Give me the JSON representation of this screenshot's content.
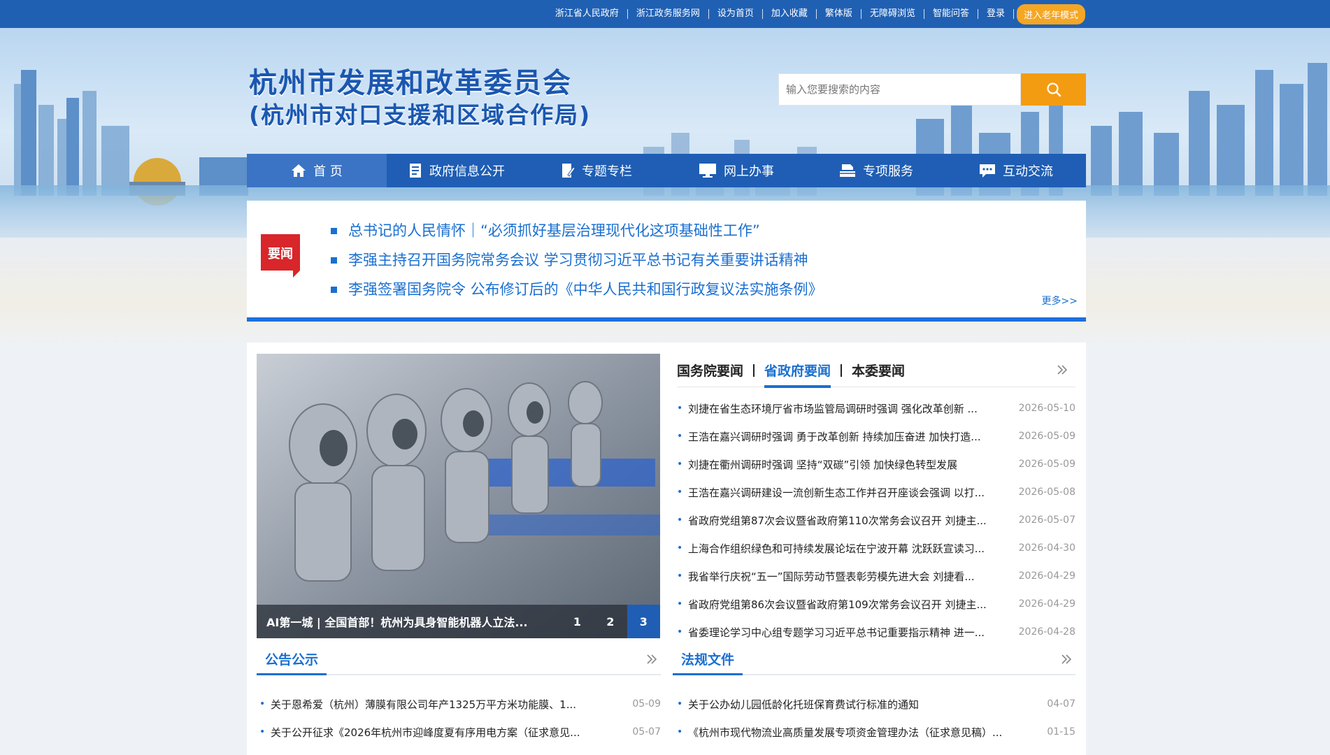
{
  "topbar": {
    "links": [
      "浙江省人民政府",
      "浙江政务服务网",
      "设为首页",
      "加入收藏",
      "繁体版",
      "无障碍浏览",
      "智能问答",
      "登录"
    ],
    "elder_mode": "进入老年模式"
  },
  "header": {
    "title_line1": "杭州市发展和改革委员会",
    "title_line2": "(杭州市对口支援和区域合作局)"
  },
  "search": {
    "placeholder": "输入您要搜索的内容"
  },
  "nav": [
    "首 页",
    "政府信息公开",
    "专题专栏",
    "网上办事",
    "专项服务",
    "互动交流"
  ],
  "headlines": {
    "badge": "要闻",
    "items": [
      "总书记的人民情怀｜“必须抓好基层治理现代化这项基础性工作”",
      "李强主持召开国务院常务会议 学习贯彻习近平总书记有关重要讲话精神",
      "李强签署国务院令 公布修订后的《中华人民共和国行政复议法实施条例》"
    ],
    "more": "更多>>"
  },
  "carousel": {
    "caption": "AI第一城 | 全国首部！杭州为具身智能机器人立法...",
    "pages": [
      "1",
      "2",
      "3"
    ],
    "active_page": "3"
  },
  "news": {
    "tabs": [
      "国务院要闻",
      "省政府要闻",
      "本委要闻"
    ],
    "active_tab": "省政府要闻",
    "items": [
      {
        "title": "刘捷在省生态环境厅省市场监管局调研时强调 强化改革创新 ...",
        "date": "2026-05-10"
      },
      {
        "title": "王浩在嘉兴调研时强调 勇于改革创新 持续加压奋进 加快打造...",
        "date": "2026-05-09"
      },
      {
        "title": "刘捷在衢州调研时强调 坚持“双碳”引领 加快绿色转型发展",
        "date": "2026-05-09"
      },
      {
        "title": "王浩在嘉兴调研建设一流创新生态工作并召开座谈会强调 以打...",
        "date": "2026-05-08"
      },
      {
        "title": "省政府党组第87次会议暨省政府第110次常务会议召开 刘捷主...",
        "date": "2026-05-07"
      },
      {
        "title": "上海合作组织绿色和可持续发展论坛在宁波开幕 沈跃跃宣读习...",
        "date": "2026-04-30"
      },
      {
        "title": "我省举行庆祝“五一”国际劳动节暨表彰劳模先进大会 刘捷看...",
        "date": "2026-04-29"
      },
      {
        "title": "省政府党组第86次会议暨省政府第109次常务会议召开 刘捷主...",
        "date": "2026-04-29"
      },
      {
        "title": "省委理论学习中心组专题学习习近平总书记重要指示精神 进一...",
        "date": "2026-04-28"
      }
    ]
  },
  "notices": {
    "title": "公告公示",
    "items": [
      {
        "title": "关于恩希爱（杭州）薄膜有限公司年产1325万平方米功能膜、1...",
        "date": "05-09"
      },
      {
        "title": "关于公开征求《2026年杭州市迎峰度夏有序用电方案（征求意见...",
        "date": "05-07"
      }
    ]
  },
  "regulations": {
    "title": "法规文件",
    "items": [
      {
        "title": "关于公办幼儿园低龄化托班保育费试行标准的通知",
        "date": "04-07"
      },
      {
        "title": "《杭州市现代物流业高质量发展专项资金管理办法（征求意见稿）...",
        "date": "01-15"
      }
    ]
  },
  "colors": {
    "primary": "#1f5eb4",
    "link_blue": "#1a6fd1",
    "orange": "#f39c12",
    "badge_red": "#d8262b"
  }
}
